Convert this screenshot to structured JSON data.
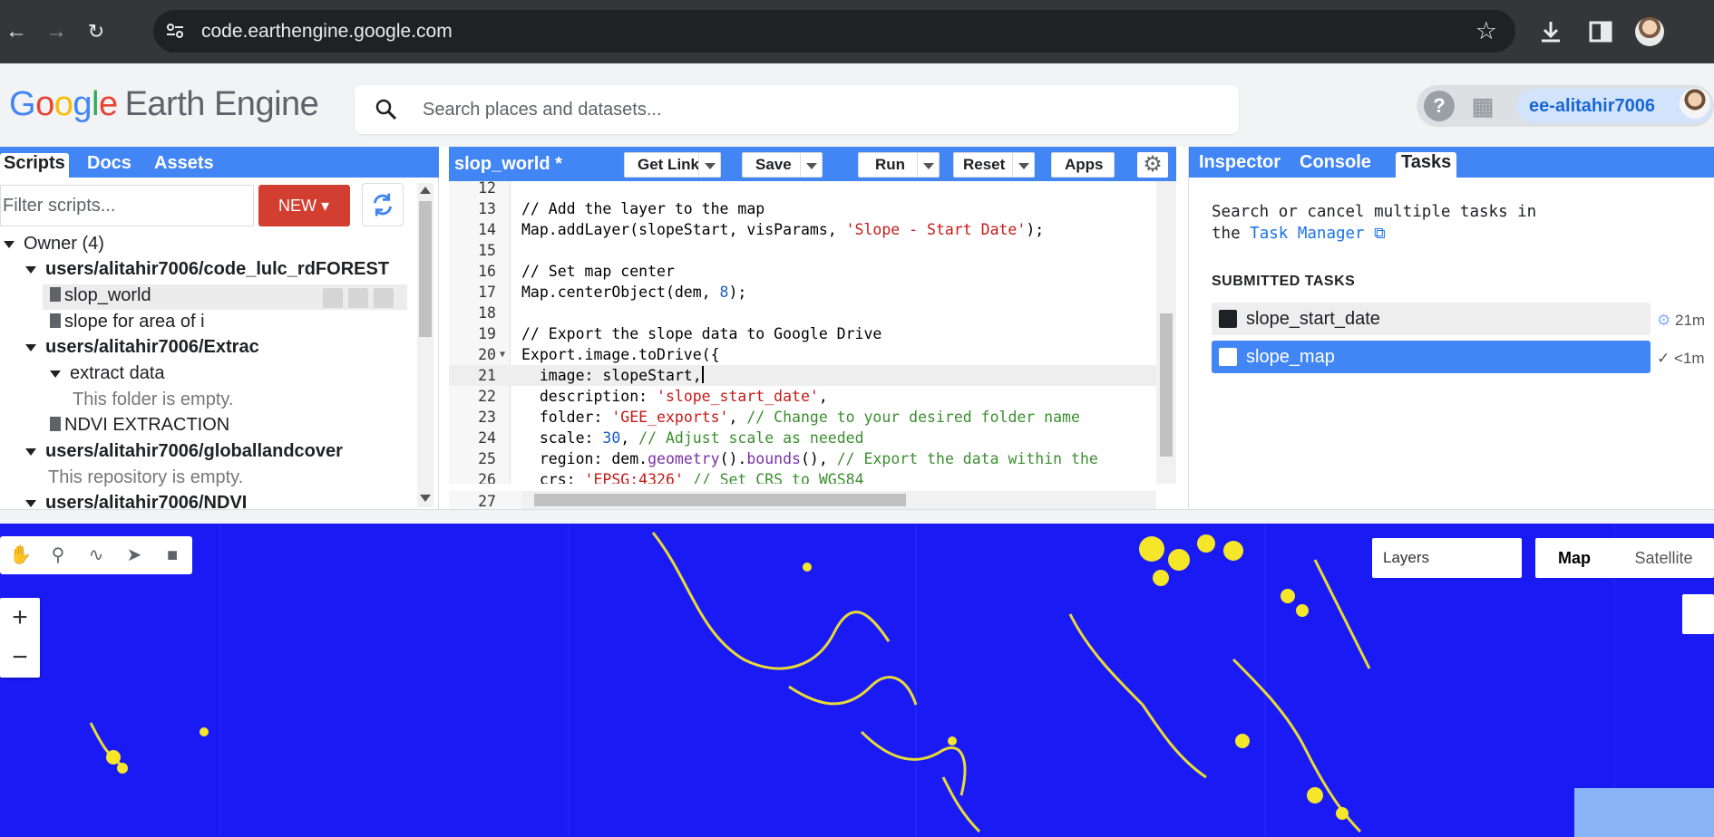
{
  "browser": {
    "url": "code.earthengine.google.com",
    "icons": [
      "back-icon",
      "forward-icon",
      "reload-icon",
      "site-info-icon",
      "star-icon",
      "download-icon",
      "sidepanel-icon",
      "profile-avatar"
    ]
  },
  "header": {
    "logo_google": [
      "G",
      "o",
      "o",
      "g",
      "l",
      "e"
    ],
    "logo_product": "Earth Engine",
    "search_placeholder": "Search places and datasets...",
    "account": "ee-alitahir7006"
  },
  "left_panel": {
    "tabs": [
      "Scripts",
      "Docs",
      "Assets"
    ],
    "filter_placeholder": "Filter scripts...",
    "new_label": "NEW",
    "tree": {
      "owner": "Owner (4)",
      "repo1": "users/alitahir7006/code_lulc_rdFOREST",
      "file1": "slop_world",
      "file2": "slope for area of i",
      "repo2": "users/alitahir7006/Extrac",
      "folder1": "extract data",
      "folder1_empty": "This folder is empty.",
      "file3": "NDVI EXTRACTION",
      "repo3": "users/alitahir7006/globallandcover",
      "repo3_empty": "This repository is empty.",
      "repo4": "users/alitahir7006/NDVI"
    }
  },
  "editor": {
    "title": "slop_world *",
    "buttons": {
      "get_link": "Get Link",
      "save": "Save",
      "run": "Run",
      "reset": "Reset",
      "apps": "Apps"
    },
    "lines": [
      {
        "n": "12",
        "code": ""
      },
      {
        "n": "13",
        "code": "// Add the layer to the map"
      },
      {
        "n": "14",
        "code": "Map.addLayer(slopeStart, visParams, 'Slope - Start Date');"
      },
      {
        "n": "15",
        "code": ""
      },
      {
        "n": "16",
        "code": "// Set map center"
      },
      {
        "n": "17",
        "code": "Map.centerObject(dem, 8);"
      },
      {
        "n": "18",
        "code": ""
      },
      {
        "n": "19",
        "code": "// Export the slope data to Google Drive"
      },
      {
        "n": "20",
        "code": "Export.image.toDrive({"
      },
      {
        "n": "21",
        "code": "  image: slopeStart,"
      },
      {
        "n": "22",
        "code": "  description: 'slope_start_date',"
      },
      {
        "n": "23",
        "code": "  folder: 'GEE_exports', // Change to your desired folder name"
      },
      {
        "n": "24",
        "code": "  scale: 30, // Adjust scale as needed"
      },
      {
        "n": "25",
        "code": "  region: dem.geometry().bounds(), // Export the data within the"
      },
      {
        "n": "26",
        "code": "  crs: 'EPSG:4326' // Set CRS to WGS84"
      },
      {
        "n": "27",
        "code": ""
      }
    ]
  },
  "right_panel": {
    "tabs": [
      "Inspector",
      "Console",
      "Tasks"
    ],
    "note_line1": "Search or cancel multiple tasks in",
    "note_the": "the",
    "note_link": "Task Manager",
    "submitted_heading": "SUBMITTED TASKS",
    "tasks": [
      {
        "name": "slope_start_date",
        "time": "21m"
      },
      {
        "name": "slope_map",
        "time": "<1m"
      }
    ]
  },
  "map": {
    "layers_label": "Layers",
    "map_type": "Map",
    "satellite_type": "Satellite",
    "zoom_in": "+",
    "zoom_out": "−",
    "base_color": "#1a1af5",
    "feature_color": "#f5e629"
  }
}
